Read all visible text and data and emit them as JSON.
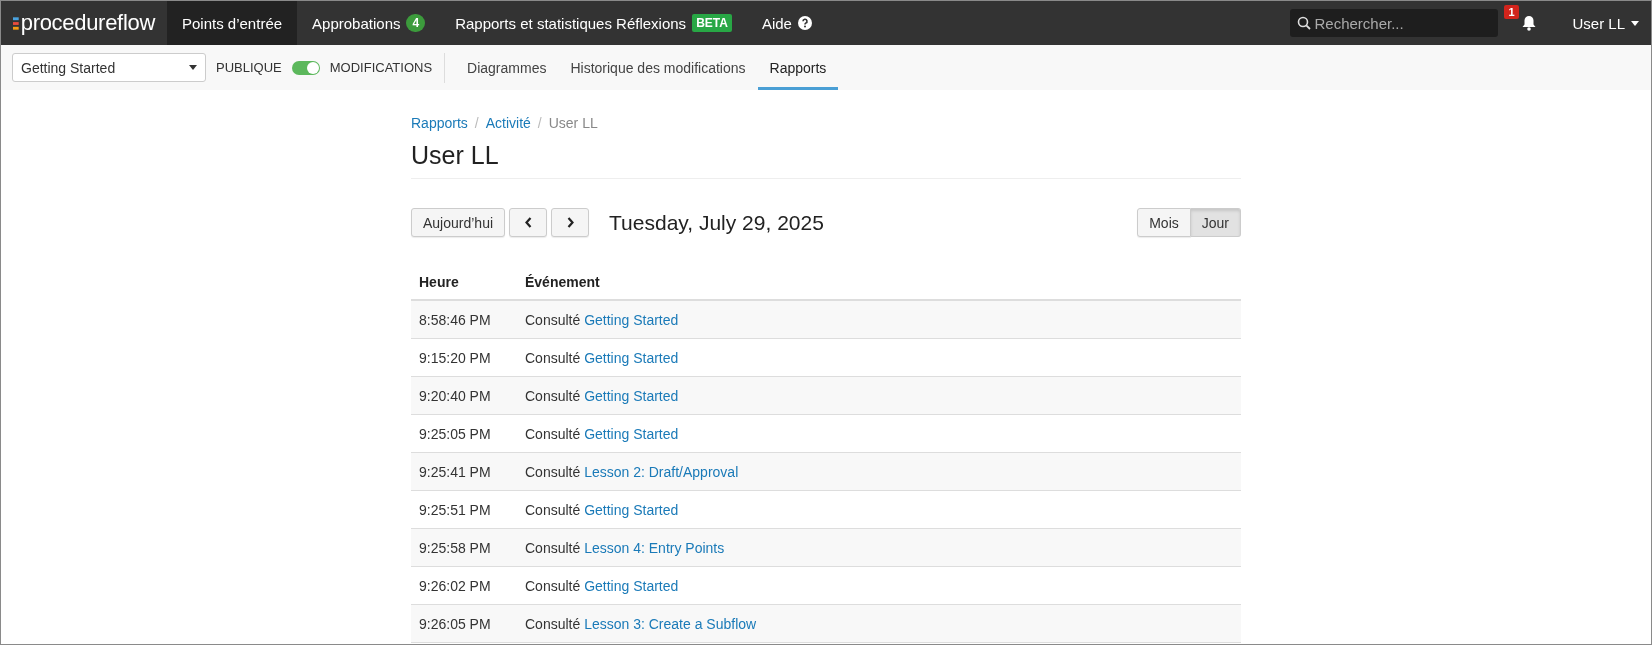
{
  "navbar": {
    "logo": "procedureflow",
    "items": [
      {
        "label": "Points d’entrée",
        "selected": true
      },
      {
        "label": "Approbations",
        "selected": false,
        "count": "4"
      },
      {
        "label": "Rapports et statistiques Réflexions",
        "selected": false,
        "tag": "BETA"
      },
      {
        "label": "Aide",
        "selected": false,
        "help": true
      }
    ],
    "search": {
      "placeholder": "Rechercher..."
    },
    "notifications": "1",
    "user": "User LL"
  },
  "subbar": {
    "flow": "Getting Started",
    "toggle": {
      "left": "PUBLIQUE",
      "right": "MODIFICATIONS",
      "on": true
    },
    "tabs": [
      {
        "label": "Diagrammes",
        "selected": false
      },
      {
        "label": "Historique des modifications",
        "selected": false
      },
      {
        "label": "Rapports",
        "selected": true
      }
    ]
  },
  "breadcrumb": {
    "separator": "/",
    "items": [
      "Rapports",
      "Activité",
      "User LL"
    ]
  },
  "title": "User LL",
  "toolbar": {
    "today": "Aujourd’hui",
    "date": "Tuesday, July 29, 2025",
    "views": [
      {
        "label": "Mois",
        "selected": false
      },
      {
        "label": "Jour",
        "selected": true
      }
    ]
  },
  "table": {
    "columns": [
      "Heure",
      "Événement"
    ],
    "rows": [
      {
        "time": "8:58:46 PM",
        "verb": "Consulté",
        "link": "Getting Started"
      },
      {
        "time": "9:15:20 PM",
        "verb": "Consulté",
        "link": "Getting Started"
      },
      {
        "time": "9:20:40 PM",
        "verb": "Consulté",
        "link": "Getting Started"
      },
      {
        "time": "9:25:05 PM",
        "verb": "Consulté",
        "link": "Getting Started"
      },
      {
        "time": "9:25:41 PM",
        "verb": "Consulté",
        "link": "Lesson 2: Draft/Approval"
      },
      {
        "time": "9:25:51 PM",
        "verb": "Consulté",
        "link": "Getting Started"
      },
      {
        "time": "9:25:58 PM",
        "verb": "Consulté",
        "link": "Lesson 4: Entry Points"
      },
      {
        "time": "9:26:02 PM",
        "verb": "Consulté",
        "link": "Getting Started"
      },
      {
        "time": "9:26:05 PM",
        "verb": "Consulté",
        "link": "Lesson 3: Create a Subflow"
      }
    ]
  }
}
